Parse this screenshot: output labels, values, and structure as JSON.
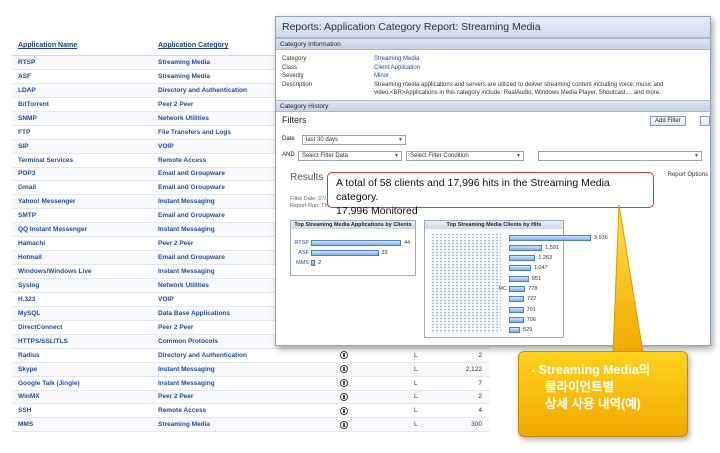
{
  "app_table": {
    "headers": [
      "Application Name",
      "Application Category"
    ],
    "rows": [
      {
        "name": "RTSP",
        "category": "Streaming Media",
        "l": "",
        "n": ""
      },
      {
        "name": "ASF",
        "category": "Streaming Media",
        "l": "",
        "n": ""
      },
      {
        "name": "LDAP",
        "category": "Directory and Authentication",
        "l": "",
        "n": ""
      },
      {
        "name": "BitTorrent",
        "category": "Peer 2 Peer",
        "l": "",
        "n": ""
      },
      {
        "name": "SNMP",
        "category": "Network Utilities",
        "l": "",
        "n": ""
      },
      {
        "name": "FTP",
        "category": "File Transfers and Logs",
        "l": "",
        "n": ""
      },
      {
        "name": "SIP",
        "category": "VOIP",
        "l": "",
        "n": ""
      },
      {
        "name": "Terminal Services",
        "category": "Remote Access",
        "l": "",
        "n": ""
      },
      {
        "name": "POP3",
        "category": "Email and Groupware",
        "l": "",
        "n": ""
      },
      {
        "name": "Gmail",
        "category": "Email and Groupware",
        "l": "",
        "n": ""
      },
      {
        "name": "Yahoo! Messenger",
        "category": "Instant Messaging",
        "l": "",
        "n": ""
      },
      {
        "name": "SMTP",
        "category": "Email and Groupware",
        "l": "",
        "n": ""
      },
      {
        "name": "QQ Instant Messenger",
        "category": "Instant Messaging",
        "l": "",
        "n": ""
      },
      {
        "name": "Hamachi",
        "category": "Peer 2 Peer",
        "l": "",
        "n": ""
      },
      {
        "name": "Hotmail",
        "category": "Email and Groupware",
        "l": "",
        "n": ""
      },
      {
        "name": "Windows/Windows Live",
        "category": "Instant Messaging",
        "l": "",
        "n": ""
      },
      {
        "name": "Syslog",
        "category": "Network Utilities",
        "l": "",
        "n": ""
      },
      {
        "name": "H.323",
        "category": "VOIP",
        "l": "",
        "n": ""
      },
      {
        "name": "MySQL",
        "category": "Data Base Applications",
        "l": "",
        "n": ""
      },
      {
        "name": "DirectConnect",
        "category": "Peer 2 Peer",
        "l": "",
        "n": ""
      },
      {
        "name": "HTTPS/SSL/TLS",
        "category": "Common Protocols",
        "l": "",
        "n": ""
      },
      {
        "name": "Radius",
        "category": "Directory and Authentication",
        "l": "L",
        "n": "2"
      },
      {
        "name": "Skype",
        "category": "Instant Messaging",
        "l": "L",
        "n": "2,122"
      },
      {
        "name": "Google Talk (Jingle)",
        "category": "Instant Messaging",
        "l": "L",
        "n": "7"
      },
      {
        "name": "WinMX",
        "category": "Peer 2 Peer",
        "l": "L",
        "n": "2"
      },
      {
        "name": "SSH",
        "category": "Remote Access",
        "l": "L",
        "n": "4"
      },
      {
        "name": "MMS",
        "category": "Streaming Media",
        "l": "L",
        "n": "300"
      }
    ]
  },
  "report": {
    "title": "Reports: Application Category Report: Streaming Media",
    "info_header": "Category Information",
    "info": [
      {
        "k": "Category",
        "v": "Streaming Media",
        "link": true
      },
      {
        "k": "Class",
        "v": "Client Application",
        "link": true
      },
      {
        "k": "Severity",
        "v": "Minor",
        "link": true
      },
      {
        "k": "Description",
        "v": "Streaming media applications and servers are utilized to deliver streaming content including voice, music and",
        "link": false
      },
      {
        "k": "",
        "v": "video.<BR>Applications in this category include: RealAudio, Windows Media Player, Shoutcast,... and more.",
        "link": false
      }
    ],
    "history_header": "Category History",
    "filters_title": "Filters",
    "add_filter": "Add Filter",
    "date_label": "Date",
    "date_value": "last 30 days",
    "and_label": "AND",
    "filter_data": "Select Filter Data",
    "filter_condition": "Select Filter Condition",
    "results_title": "Results",
    "report_options": "Report Options",
    "meta_line1": "Filter Date:     07/..../2011 - 08/../2011",
    "meta_line2": "Report Run:      Thu Aug 25, 2011 3:51:41 PM PST",
    "apps_panel_title": "Top Streaming Media Applications by Clients",
    "apps": [
      {
        "label": "RTSP",
        "value": 44
      },
      {
        "label": "ASF",
        "value": 33
      },
      {
        "label": "MMS",
        "value": 2
      }
    ],
    "clients_panel_title": "Top Streaming Media Clients by Hits",
    "clients": [
      {
        "label": "",
        "value": 3936,
        "text": "3,936"
      },
      {
        "label": "",
        "value": 1591,
        "text": "1,591"
      },
      {
        "label": "",
        "value": 1263,
        "text": "1,263"
      },
      {
        "label": "",
        "value": 1047,
        "text": "1,047"
      },
      {
        "label": "",
        "value": 951,
        "text": "951"
      },
      {
        "label": "MC",
        "value": 778,
        "text": "778"
      },
      {
        "label": "",
        "value": 722,
        "text": "722"
      },
      {
        "label": "",
        "value": 701,
        "text": "701"
      },
      {
        "label": "",
        "value": 706,
        "text": "706"
      },
      {
        "label": "",
        "value": 529,
        "text": "529"
      }
    ]
  },
  "callout": {
    "line1": "A total of 58 clients and 17,996 hits in the Streaming Media category.",
    "line2": "17,996 Monitored"
  },
  "korean_note": {
    "line1": "- Streaming Media의",
    "line2": "클라이언트별",
    "line3": "상세 사용 내역(예)"
  },
  "colors": {
    "link": "#1f4aa8",
    "callout_border": "#dd3333",
    "note_bg": "#f5b800",
    "bar": "#7fb0e6"
  }
}
